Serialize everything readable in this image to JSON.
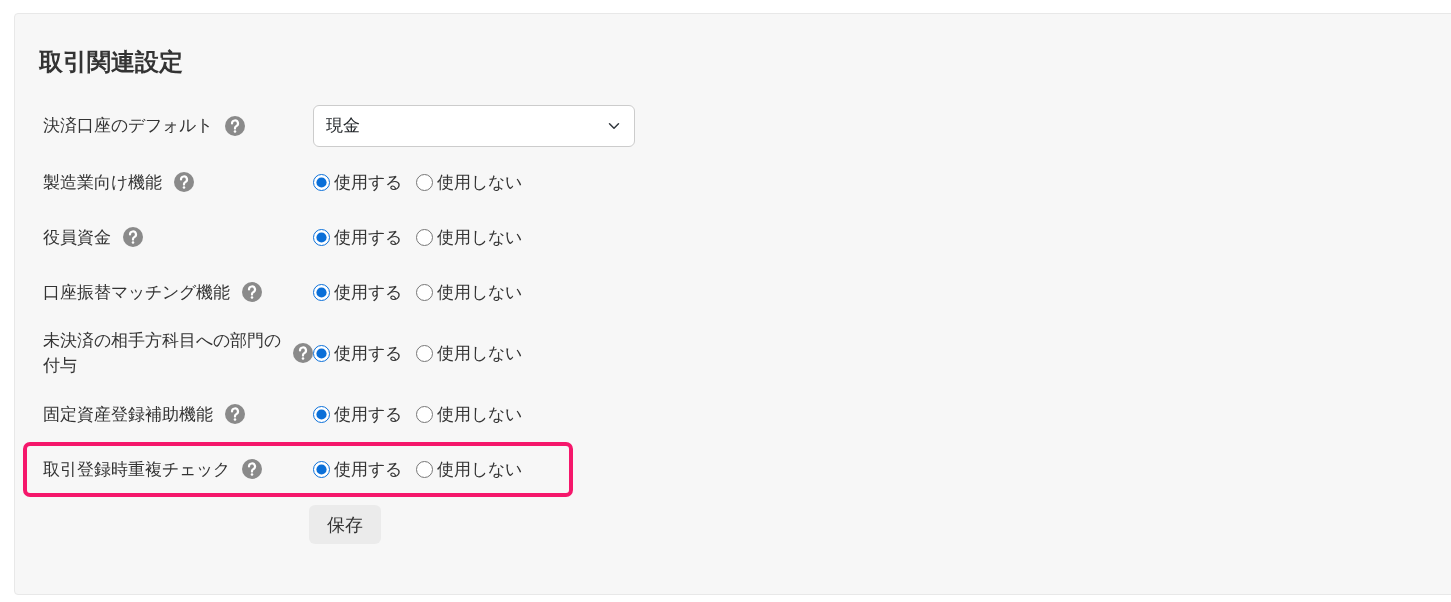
{
  "panel": {
    "title": "取引関連設定",
    "settings": [
      {
        "kind": "select",
        "label": "決済口座のデフォルト",
        "value": "現金",
        "highlighted": false
      },
      {
        "kind": "radio",
        "label": "製造業向け機能",
        "highlighted": false,
        "options": [
          {
            "label": "使用する",
            "selected": true
          },
          {
            "label": "使用しない",
            "selected": false
          }
        ]
      },
      {
        "kind": "radio",
        "label": "役員資金",
        "highlighted": false,
        "options": [
          {
            "label": "使用する",
            "selected": true
          },
          {
            "label": "使用しない",
            "selected": false
          }
        ]
      },
      {
        "kind": "radio",
        "label": "口座振替マッチング機能",
        "highlighted": false,
        "options": [
          {
            "label": "使用する",
            "selected": true
          },
          {
            "label": "使用しない",
            "selected": false
          }
        ]
      },
      {
        "kind": "radio",
        "label": "未決済の相手方科目への部門の付与",
        "highlighted": false,
        "options": [
          {
            "label": "使用する",
            "selected": true
          },
          {
            "label": "使用しない",
            "selected": false
          }
        ]
      },
      {
        "kind": "radio",
        "label": "固定資産登録補助機能",
        "highlighted": false,
        "options": [
          {
            "label": "使用する",
            "selected": true
          },
          {
            "label": "使用しない",
            "selected": false
          }
        ]
      },
      {
        "kind": "radio",
        "label": "取引登録時重複チェック",
        "highlighted": true,
        "options": [
          {
            "label": "使用する",
            "selected": true
          },
          {
            "label": "使用しない",
            "selected": false
          }
        ]
      }
    ],
    "save_button": "保存"
  }
}
